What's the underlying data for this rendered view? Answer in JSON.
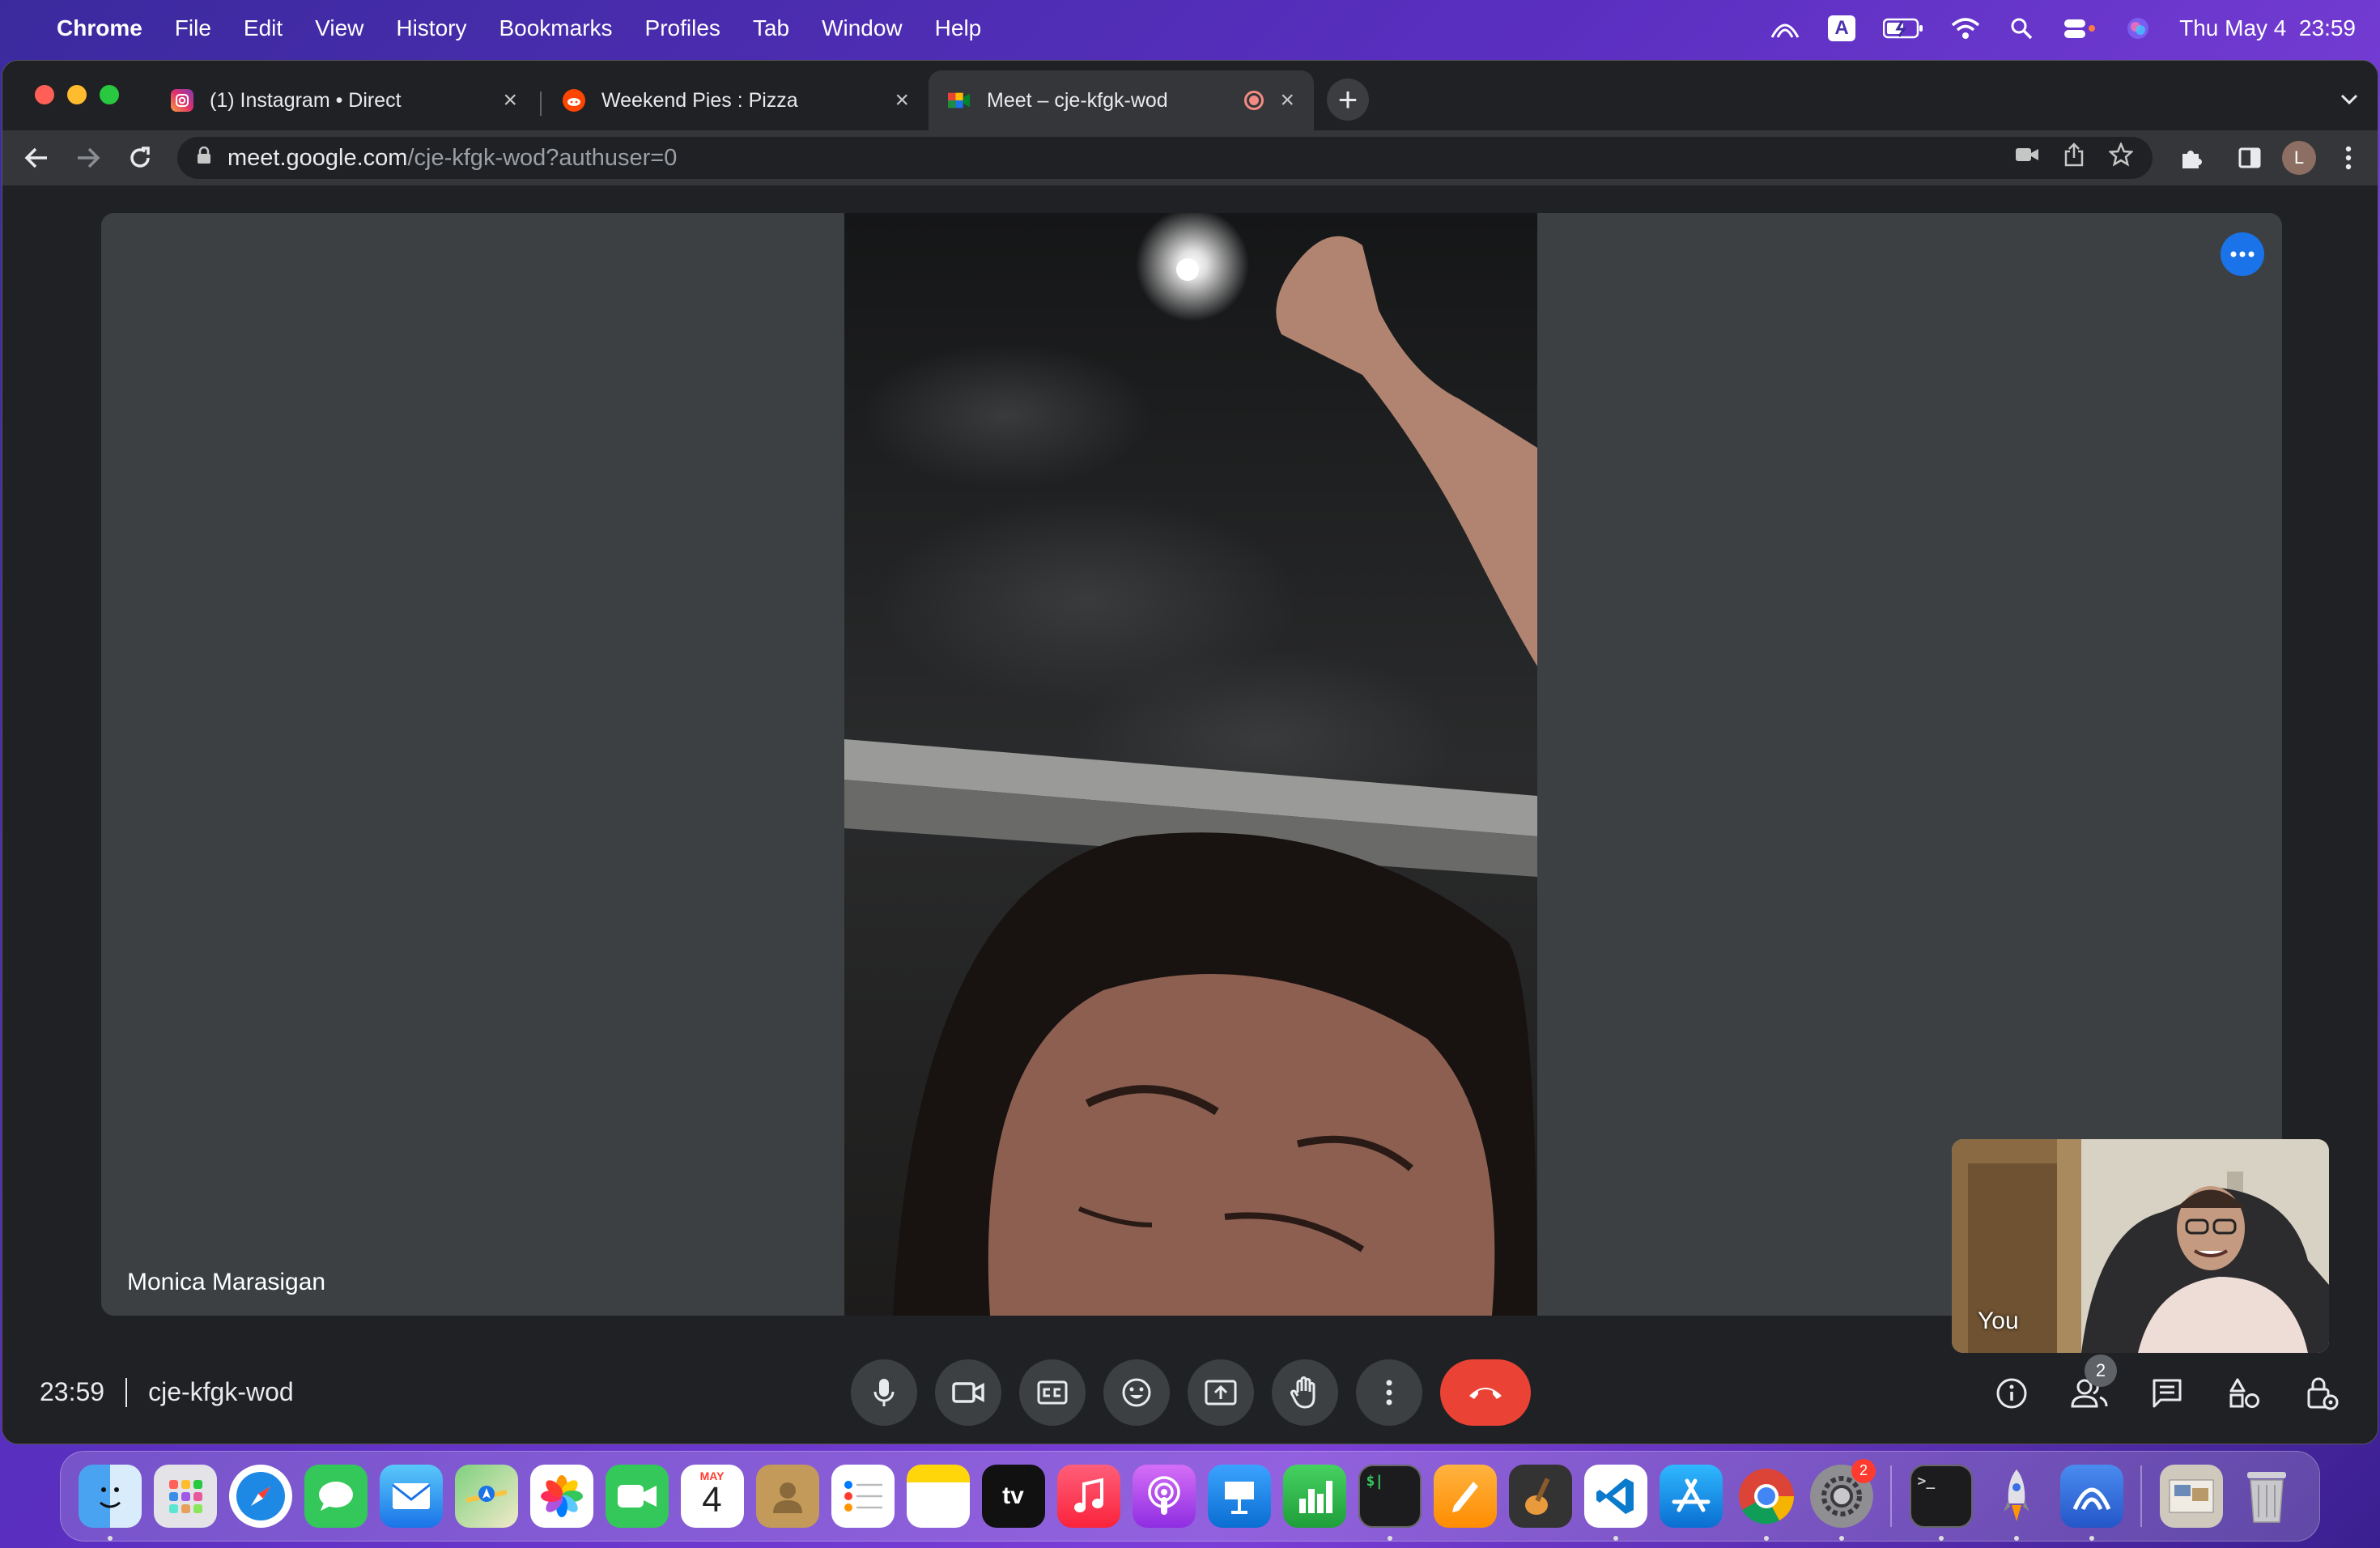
{
  "menubar": {
    "app": "Chrome",
    "items": [
      "File",
      "Edit",
      "View",
      "History",
      "Bookmarks",
      "Profiles",
      "Tab",
      "Window",
      "Help"
    ],
    "input_source": "A",
    "datetime": "Thu May 4  23:59"
  },
  "tabs": [
    {
      "title": "(1) Instagram • Direct",
      "icon": "instagram-icon",
      "active": false
    },
    {
      "title": "Weekend Pies : Pizza",
      "icon": "reddit-icon",
      "active": false
    },
    {
      "title": "Meet – cje-kfgk-wod",
      "icon": "meet-icon",
      "active": true,
      "recording": true
    }
  ],
  "address": {
    "host": "meet.google.com",
    "path": "/cje-kfgk-wod?authuser=0"
  },
  "profile_initial": "L",
  "meet": {
    "main_participant": "Monica Marasigan",
    "self_label": "You",
    "time": "23:59",
    "meeting_code": "cje-kfgk-wod",
    "people_count": "2"
  },
  "controls": [
    "mic-icon",
    "camera-icon",
    "captions-icon",
    "emoji-icon",
    "present-icon",
    "raise-hand-icon",
    "more-options-icon",
    "end-call-icon"
  ],
  "right_controls": [
    "info-icon",
    "people-icon",
    "chat-icon",
    "activities-icon",
    "host-controls-icon"
  ],
  "dock": {
    "calendar_month": "MAY",
    "calendar_day": "4",
    "tv_label": "tv",
    "settings_badge": "2"
  },
  "colors": {
    "meet_bg": "#202124",
    "tile_bg": "#3c4043",
    "accent_blue": "#1a73e8",
    "end_call_red": "#ea4335"
  }
}
